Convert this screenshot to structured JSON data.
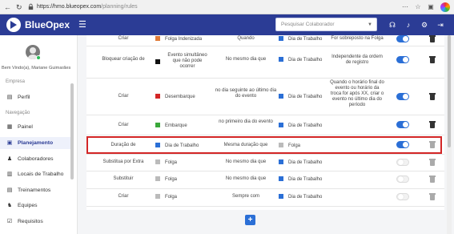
{
  "browser": {
    "url_domain": "https://hmo.blueopex.com",
    "url_path": "/planning/rules"
  },
  "header": {
    "brand": "BlueOpex",
    "search_placeholder": "Pesquisar Colaborador"
  },
  "sidebar": {
    "welcome": "Bem Vindo(a), Mariane Guimarães",
    "section_empresa": "Empresa",
    "perfil": "Perfil",
    "section_navegacao": "Navegação",
    "painel": "Painel",
    "planejamento": "Planejamento",
    "colaboradores": "Colaboradores",
    "locais": "Locais de Trabalho",
    "treinamentos": "Treinamentos",
    "equipes": "Equipes",
    "requisitos": "Requisitos"
  },
  "colors": {
    "primary": "#2b3c95",
    "accent_blue": "#2b6fd6",
    "orange": "#e07b39",
    "red": "#d32626",
    "green": "#3aa83a",
    "black": "#111111",
    "gray": "#bbbbbb",
    "highlight": "#d32626"
  },
  "rows": [
    {
      "action": "Criar",
      "type": "Folga Indenizada",
      "type_color": "orange",
      "when": "Quando",
      "target": "Dia de Trabalho",
      "target_color": "blue",
      "note": "For sobreposto na Folga",
      "enabled": true
    },
    {
      "action": "Bloquear criação de",
      "type": "Evento simultâneo que não pode ocorrer",
      "type_color": "black",
      "when": "No mesmo dia que",
      "target": "Dia de Trabalho",
      "target_color": "blue",
      "note": "Independente da ordem de registro",
      "enabled": true
    },
    {
      "action": "Criar",
      "type": "Desembarque",
      "type_color": "red",
      "when": "no dia seguinte ao último dia do evento",
      "target": "Dia de Trabalho",
      "target_color": "blue",
      "note": "Quando o horário final do evento ou horário da troca for após XX, criar o evento no último dia do período",
      "enabled": true
    },
    {
      "action": "Criar",
      "type": "Embarque",
      "type_color": "green",
      "when": "no primeiro dia do evento",
      "target": "Dia de Trabalho",
      "target_color": "blue",
      "note": "",
      "enabled": true
    },
    {
      "action": "Duração de",
      "type": "Dia de Trabalho",
      "type_color": "blue",
      "when": "Mesma duração que",
      "target": "Folga",
      "target_color": "gray",
      "note": "",
      "enabled": true
    },
    {
      "action": "Substitua por Extra",
      "type": "Folga",
      "type_color": "gray",
      "when": "No mesmo dia que",
      "target": "Dia de Trabalho",
      "target_color": "blue",
      "note": "",
      "enabled": false
    },
    {
      "action": "Substituir",
      "type": "Folga",
      "type_color": "gray",
      "when": "No mesmo dia que",
      "target": "Dia de Trabalho",
      "target_color": "blue",
      "note": "",
      "enabled": false
    },
    {
      "action": "Criar",
      "type": "Folga",
      "type_color": "gray",
      "when": "Sempre com",
      "target": "Dia de Trabalho",
      "target_color": "blue",
      "note": "",
      "enabled": false
    }
  ],
  "add_button": "+"
}
